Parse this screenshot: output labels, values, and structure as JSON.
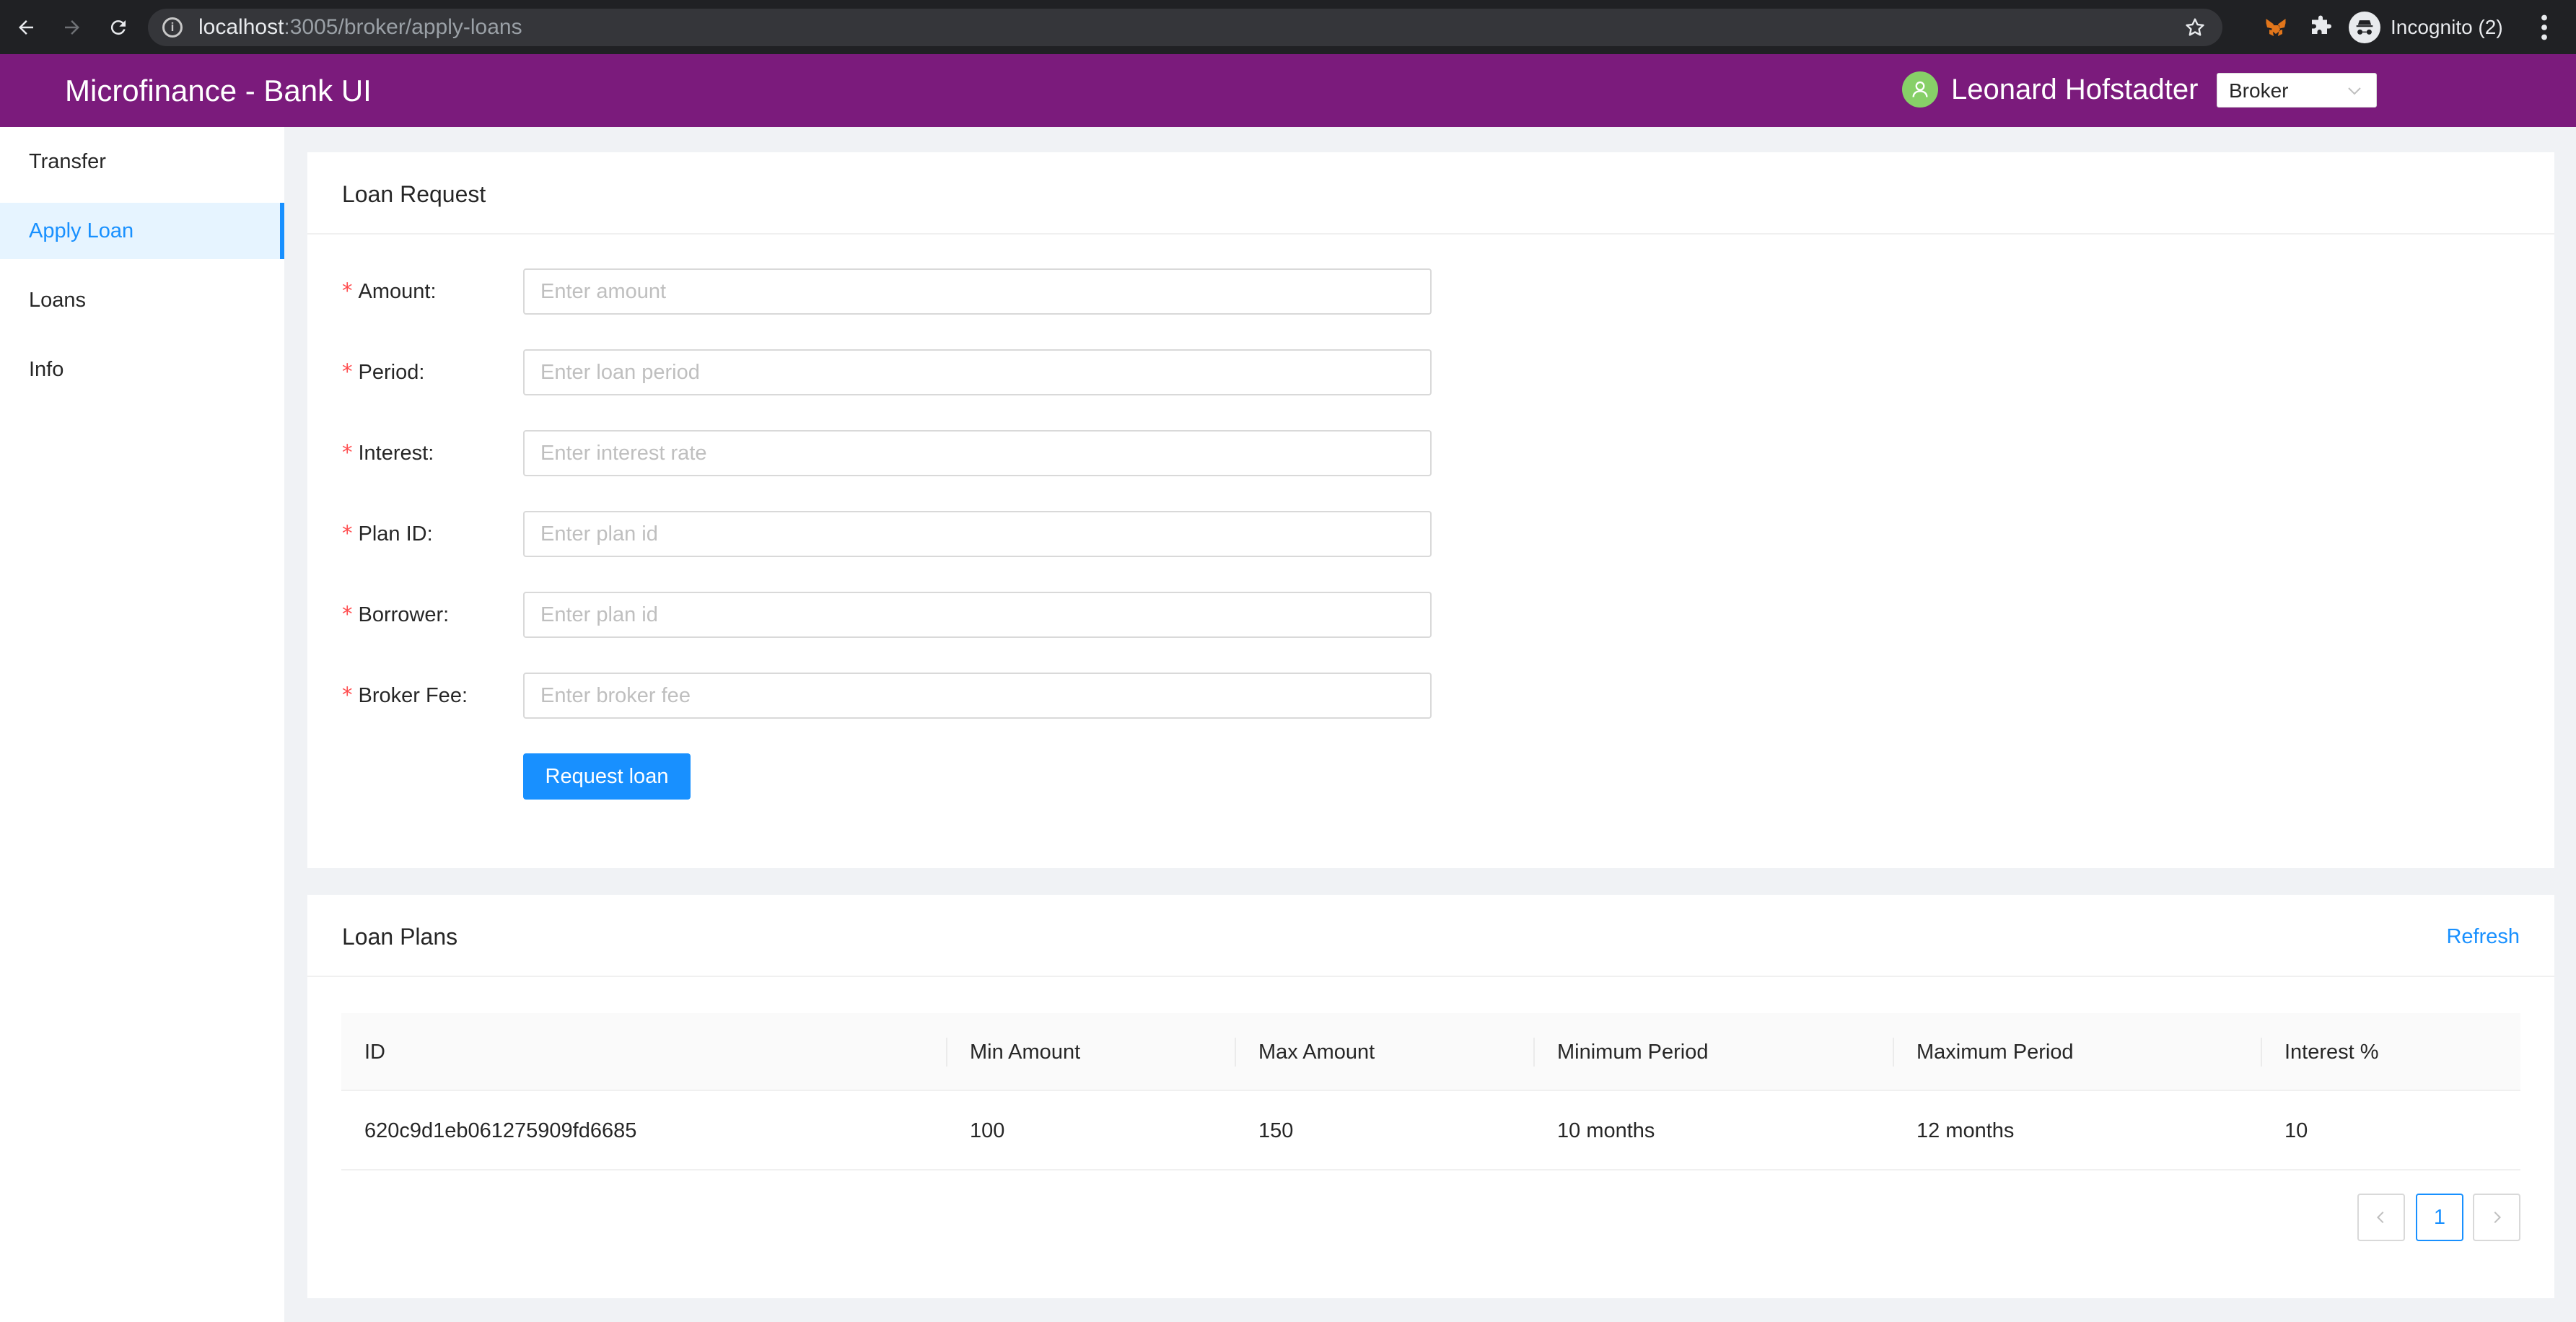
{
  "browser": {
    "url_host": "localhost",
    "url_path": ":3005/broker/apply-loans",
    "incognito_label": "Incognito (2)",
    "icons": [
      "back-arrow-icon",
      "forward-arrow-icon",
      "reload-icon",
      "info-icon",
      "bookmark-star-icon",
      "metamask-icon",
      "extensions-puzzle-icon",
      "incognito-icon",
      "more-vertical-icon"
    ]
  },
  "header": {
    "title": "Microfinance - Bank UI",
    "user_name": "Leonard Hofstadter",
    "role_selected": "Broker",
    "brand_color": "#7b1b7c"
  },
  "sidebar": {
    "items": [
      {
        "label": "Transfer"
      },
      {
        "label": "Apply Loan",
        "active": true
      },
      {
        "label": "Loans"
      },
      {
        "label": "Info"
      }
    ]
  },
  "loan_request": {
    "title": "Loan Request",
    "fields": [
      {
        "label": "Amount",
        "placeholder": "Enter amount",
        "value": ""
      },
      {
        "label": "Period",
        "placeholder": "Enter loan period",
        "value": ""
      },
      {
        "label": "Interest",
        "placeholder": "Enter interest rate",
        "value": ""
      },
      {
        "label": "Plan ID",
        "placeholder": "Enter plan id",
        "value": ""
      },
      {
        "label": "Borrower",
        "placeholder": "Enter plan id",
        "value": ""
      },
      {
        "label": "Broker Fee",
        "placeholder": "Enter broker fee",
        "value": ""
      }
    ],
    "required_mark": "*",
    "label_suffix": ":",
    "submit_label": "Request loan"
  },
  "loan_plans": {
    "title": "Loan Plans",
    "refresh_label": "Refresh",
    "columns": [
      "ID",
      "Min Amount",
      "Max Amount",
      "Minimum Period",
      "Maximum Period",
      "Interest %"
    ],
    "rows": [
      [
        "620c9d1eb061275909fd6685",
        "100",
        "150",
        "10 months",
        "12 months",
        "10"
      ]
    ],
    "pagination": {
      "current_page": "1"
    }
  },
  "colors": {
    "accent": "#1890ff",
    "required": "#ff4d4f",
    "avatar": "#87d068"
  }
}
